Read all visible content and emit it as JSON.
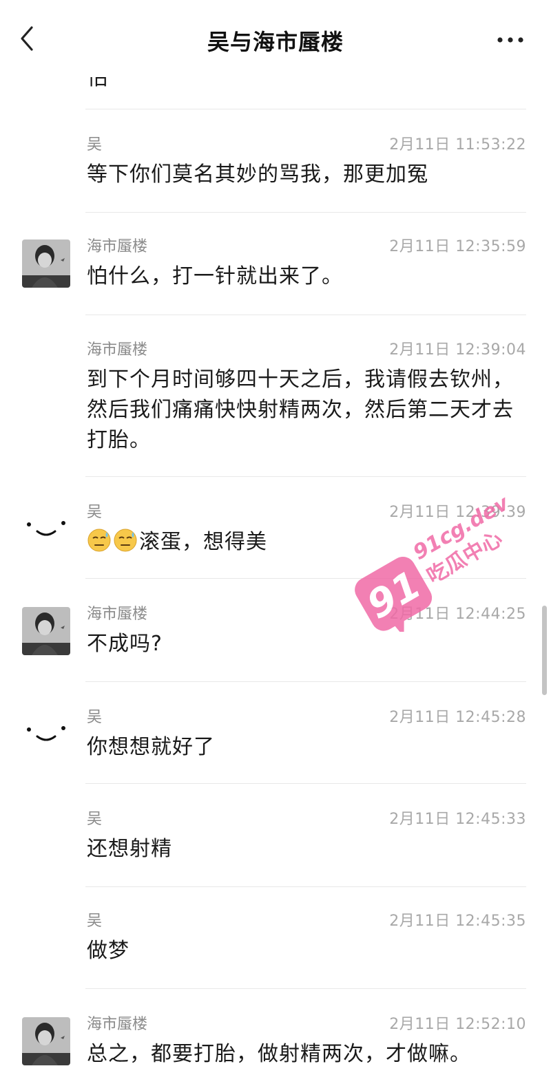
{
  "header": {
    "title": "吴与海市蜃楼"
  },
  "partial_top_text": "怕",
  "messages": [
    {
      "sender": "吴",
      "time": "2月11日 11:53:22",
      "text": "等下你们莫名其妙的骂我，那更加冤",
      "avatar": "none"
    },
    {
      "sender": "海市蜃楼",
      "time": "2月11日 12:35:59",
      "text": "怕什么，打一针就出来了。",
      "avatar": "photo"
    },
    {
      "sender": "海市蜃楼",
      "time": "2月11日 12:39:04",
      "text": "到下个月时间够四十天之后，我请假去钦州，然后我们痛痛快快射精两次，然后第二天才去打胎。",
      "avatar": "none"
    },
    {
      "sender": "吴",
      "time": "2月11日 12:39:39",
      "text": "滚蛋，想得美",
      "emoji_prefix": [
        "cold-sweat-emoji",
        "cold-sweat-emoji"
      ],
      "avatar": "smiley"
    },
    {
      "sender": "海市蜃楼",
      "time": "2月11日 12:44:25",
      "text": "不成吗?",
      "avatar": "photo"
    },
    {
      "sender": "吴",
      "time": "2月11日 12:45:28",
      "text": "你想想就好了",
      "avatar": "smiley"
    },
    {
      "sender": "吴",
      "time": "2月11日 12:45:33",
      "text": "还想射精",
      "avatar": "none"
    },
    {
      "sender": "吴",
      "time": "2月11日 12:45:35",
      "text": "做梦",
      "avatar": "none"
    },
    {
      "sender": "海市蜃楼",
      "time": "2月11日 12:52:10",
      "text": "总之，都要打胎，做射精两次，才做嘛。",
      "avatar": "photo"
    }
  ],
  "watermark": {
    "number": "91",
    "site": "91cg.dev",
    "name": "吃瓜中心"
  },
  "colors": {
    "watermark_pink": "#f06aa6",
    "time_gray": "#a8a8a8",
    "sender_gray": "#8a8a8a"
  }
}
